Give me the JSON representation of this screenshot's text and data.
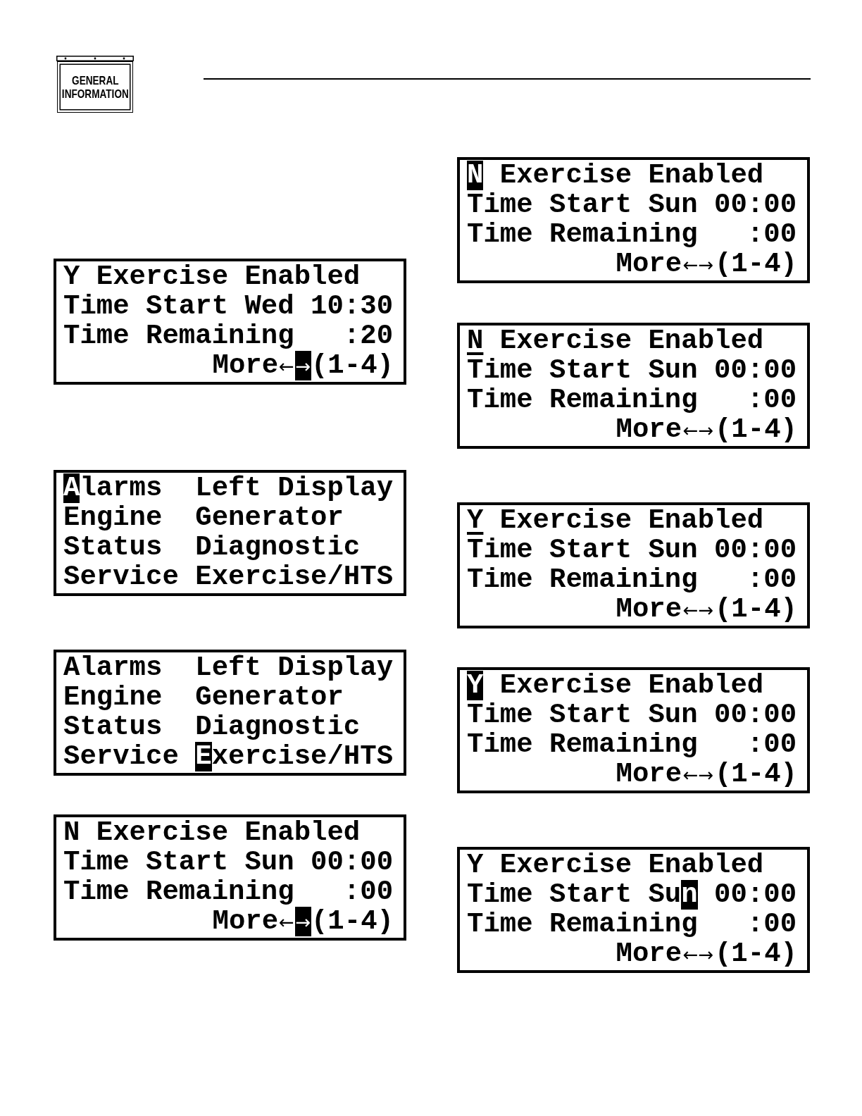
{
  "header": {
    "section_badge": {
      "title": [
        "GENERAL",
        "INFORMATION"
      ]
    }
  },
  "columns": [
    {
      "displays": [
        {
          "lines": [
            {
              "kind": "text",
              "segments": [
                {
                  "text": "Y Exercise Enabled",
                  "kind": "text",
                  "highlighted": false,
                  "underlined": false
                }
              ]
            },
            {
              "kind": "text",
              "segments": [
                {
                  "text": "Time Start Wed 10:30",
                  "kind": "text",
                  "highlighted": false,
                  "underlined": false
                }
              ]
            },
            {
              "kind": "text",
              "segments": [
                {
                  "text": "Time Remaining   :20",
                  "kind": "text",
                  "highlighted": false,
                  "underlined": false
                }
              ]
            },
            {
              "kind": "footer",
              "segments": [
                {
                  "text": "More",
                  "kind": "text",
                  "highlighted": false,
                  "underlined": false
                },
                {
                  "text": "←",
                  "kind": "arrow",
                  "highlighted": false,
                  "underlined": false
                },
                {
                  "text": "→",
                  "kind": "arrow",
                  "highlighted": true,
                  "underlined": false
                },
                {
                  "text": "(1-4)",
                  "kind": "text",
                  "highlighted": false,
                  "underlined": false
                }
              ]
            }
          ]
        },
        {
          "lines": [
            {
              "kind": "text",
              "segments": [
                {
                  "text": "A",
                  "kind": "text",
                  "highlighted": true,
                  "underlined": false
                },
                {
                  "text": "larms  Left Display",
                  "kind": "text",
                  "highlighted": false,
                  "underlined": false
                }
              ]
            },
            {
              "kind": "text",
              "segments": [
                {
                  "text": "Engine  Generator",
                  "kind": "text",
                  "highlighted": false,
                  "underlined": false
                }
              ]
            },
            {
              "kind": "text",
              "segments": [
                {
                  "text": "Status  Diagnostic",
                  "kind": "text",
                  "highlighted": false,
                  "underlined": false
                }
              ]
            },
            {
              "kind": "text",
              "segments": [
                {
                  "text": "Service Exercise/HTS",
                  "kind": "text",
                  "highlighted": false,
                  "underlined": false
                }
              ]
            }
          ]
        },
        {
          "lines": [
            {
              "kind": "text",
              "segments": [
                {
                  "text": "Alarms  Left Display",
                  "kind": "text",
                  "highlighted": false,
                  "underlined": false
                }
              ]
            },
            {
              "kind": "text",
              "segments": [
                {
                  "text": "Engine  Generator",
                  "kind": "text",
                  "highlighted": false,
                  "underlined": false
                }
              ]
            },
            {
              "kind": "text",
              "segments": [
                {
                  "text": "Status  Diagnostic",
                  "kind": "text",
                  "highlighted": false,
                  "underlined": false
                }
              ]
            },
            {
              "kind": "text",
              "segments": [
                {
                  "text": "Service ",
                  "kind": "text",
                  "highlighted": false,
                  "underlined": false
                },
                {
                  "text": "E",
                  "kind": "text",
                  "highlighted": true,
                  "underlined": false
                },
                {
                  "text": "xercise/HTS",
                  "kind": "text",
                  "highlighted": false,
                  "underlined": false
                }
              ]
            }
          ]
        },
        {
          "lines": [
            {
              "kind": "text",
              "segments": [
                {
                  "text": "N Exercise Enabled",
                  "kind": "text",
                  "highlighted": false,
                  "underlined": false
                }
              ]
            },
            {
              "kind": "text",
              "segments": [
                {
                  "text": "Time Start Sun 00:00",
                  "kind": "text",
                  "highlighted": false,
                  "underlined": false
                }
              ]
            },
            {
              "kind": "text",
              "segments": [
                {
                  "text": "Time Remaining   :00",
                  "kind": "text",
                  "highlighted": false,
                  "underlined": false
                }
              ]
            },
            {
              "kind": "footer",
              "segments": [
                {
                  "text": "More",
                  "kind": "text",
                  "highlighted": false,
                  "underlined": false
                },
                {
                  "text": "←",
                  "kind": "arrow",
                  "highlighted": false,
                  "underlined": false
                },
                {
                  "text": "→",
                  "kind": "arrow",
                  "highlighted": true,
                  "underlined": false
                },
                {
                  "text": "(1-4)",
                  "kind": "text",
                  "highlighted": false,
                  "underlined": false
                }
              ]
            }
          ]
        }
      ]
    },
    {
      "displays": [
        {
          "lines": [
            {
              "kind": "text",
              "segments": [
                {
                  "text": "N",
                  "kind": "text",
                  "highlighted": true,
                  "underlined": false
                },
                {
                  "text": " Exercise Enabled",
                  "kind": "text",
                  "highlighted": false,
                  "underlined": false
                }
              ]
            },
            {
              "kind": "text",
              "segments": [
                {
                  "text": "Time Start Sun 00:00",
                  "kind": "text",
                  "highlighted": false,
                  "underlined": false
                }
              ]
            },
            {
              "kind": "text",
              "segments": [
                {
                  "text": "Time Remaining   :00",
                  "kind": "text",
                  "highlighted": false,
                  "underlined": false
                }
              ]
            },
            {
              "kind": "footer",
              "segments": [
                {
                  "text": "More",
                  "kind": "text",
                  "highlighted": false,
                  "underlined": false
                },
                {
                  "text": "←→",
                  "kind": "arrow",
                  "highlighted": false,
                  "underlined": false
                },
                {
                  "text": "(1-4)",
                  "kind": "text",
                  "highlighted": false,
                  "underlined": false
                }
              ]
            }
          ]
        },
        {
          "lines": [
            {
              "kind": "text",
              "segments": [
                {
                  "text": "N",
                  "kind": "text",
                  "highlighted": false,
                  "underlined": true
                },
                {
                  "text": " Exercise Enabled",
                  "kind": "text",
                  "highlighted": false,
                  "underlined": false
                }
              ]
            },
            {
              "kind": "text",
              "segments": [
                {
                  "text": "Time Start Sun 00:00",
                  "kind": "text",
                  "highlighted": false,
                  "underlined": false
                }
              ]
            },
            {
              "kind": "text",
              "segments": [
                {
                  "text": "Time Remaining   :00",
                  "kind": "text",
                  "highlighted": false,
                  "underlined": false
                }
              ]
            },
            {
              "kind": "footer",
              "segments": [
                {
                  "text": "More",
                  "kind": "text",
                  "highlighted": false,
                  "underlined": false
                },
                {
                  "text": "←→",
                  "kind": "arrow",
                  "highlighted": false,
                  "underlined": false
                },
                {
                  "text": "(1-4)",
                  "kind": "text",
                  "highlighted": false,
                  "underlined": false
                }
              ]
            }
          ]
        },
        {
          "lines": [
            {
              "kind": "text",
              "segments": [
                {
                  "text": "Y",
                  "kind": "text",
                  "highlighted": false,
                  "underlined": true
                },
                {
                  "text": " Exercise Enabled",
                  "kind": "text",
                  "highlighted": false,
                  "underlined": false
                }
              ]
            },
            {
              "kind": "text",
              "segments": [
                {
                  "text": "Time Start Sun 00:00",
                  "kind": "text",
                  "highlighted": false,
                  "underlined": false
                }
              ]
            },
            {
              "kind": "text",
              "segments": [
                {
                  "text": "Time Remaining   :00",
                  "kind": "text",
                  "highlighted": false,
                  "underlined": false
                }
              ]
            },
            {
              "kind": "footer",
              "segments": [
                {
                  "text": "More",
                  "kind": "text",
                  "highlighted": false,
                  "underlined": false
                },
                {
                  "text": "←→",
                  "kind": "arrow",
                  "highlighted": false,
                  "underlined": false
                },
                {
                  "text": "(1-4)",
                  "kind": "text",
                  "highlighted": false,
                  "underlined": false
                }
              ]
            }
          ]
        },
        {
          "lines": [
            {
              "kind": "text",
              "segments": [
                {
                  "text": "Y",
                  "kind": "text",
                  "highlighted": true,
                  "underlined": false
                },
                {
                  "text": " Exercise Enabled",
                  "kind": "text",
                  "highlighted": false,
                  "underlined": false
                }
              ]
            },
            {
              "kind": "text",
              "segments": [
                {
                  "text": "Time Start Sun 00:00",
                  "kind": "text",
                  "highlighted": false,
                  "underlined": false
                }
              ]
            },
            {
              "kind": "text",
              "segments": [
                {
                  "text": "Time Remaining   :00",
                  "kind": "text",
                  "highlighted": false,
                  "underlined": false
                }
              ]
            },
            {
              "kind": "footer",
              "segments": [
                {
                  "text": "More",
                  "kind": "text",
                  "highlighted": false,
                  "underlined": false
                },
                {
                  "text": "←→",
                  "kind": "arrow",
                  "highlighted": false,
                  "underlined": false
                },
                {
                  "text": "(1-4)",
                  "kind": "text",
                  "highlighted": false,
                  "underlined": false
                }
              ]
            }
          ]
        },
        {
          "lines": [
            {
              "kind": "text",
              "segments": [
                {
                  "text": "Y Exercise Enabled",
                  "kind": "text",
                  "highlighted": false,
                  "underlined": false
                }
              ]
            },
            {
              "kind": "text",
              "segments": [
                {
                  "text": "Time Start Su",
                  "kind": "text",
                  "highlighted": false,
                  "underlined": false
                },
                {
                  "text": "n",
                  "kind": "text",
                  "highlighted": true,
                  "underlined": false
                },
                {
                  "text": " 00:00",
                  "kind": "text",
                  "highlighted": false,
                  "underlined": false
                }
              ]
            },
            {
              "kind": "text",
              "segments": [
                {
                  "text": "Time Remaining   :00",
                  "kind": "text",
                  "highlighted": false,
                  "underlined": false
                }
              ]
            },
            {
              "kind": "footer",
              "segments": [
                {
                  "text": "More",
                  "kind": "text",
                  "highlighted": false,
                  "underlined": false
                },
                {
                  "text": "←→",
                  "kind": "arrow",
                  "highlighted": false,
                  "underlined": false
                },
                {
                  "text": "(1-4)",
                  "kind": "text",
                  "highlighted": false,
                  "underlined": false
                }
              ]
            }
          ]
        }
      ]
    }
  ]
}
